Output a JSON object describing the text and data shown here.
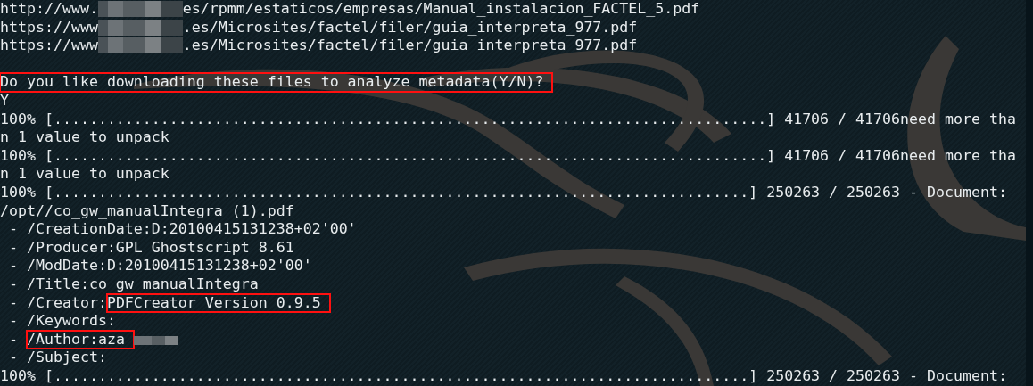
{
  "terminal": {
    "lines": [
      {
        "kind": "text",
        "segments": [
          {
            "kind": "text",
            "text": "http://www.",
            "highlighted": false
          },
          {
            "kind": "blur"
          },
          {
            "kind": "text",
            "text": "es/rpmm/estaticos/empresas/Manual_instalacion_FACTEL_5.pdf",
            "highlighted": false
          }
        ]
      },
      {
        "kind": "text",
        "segments": [
          {
            "kind": "text",
            "text": "https://www",
            "highlighted": false
          },
          {
            "kind": "blur"
          },
          {
            "kind": "text",
            "text": ".es/Microsites/factel/filer/guia_interpreta_977.pdf",
            "highlighted": false
          }
        ]
      },
      {
        "kind": "text",
        "segments": [
          {
            "kind": "text",
            "text": "https://www",
            "highlighted": false
          },
          {
            "kind": "blur"
          },
          {
            "kind": "text",
            "text": ".es/Microsites/factel/filer/guia_interpreta_977.pdf",
            "highlighted": false
          }
        ]
      },
      {
        "kind": "blank"
      },
      {
        "kind": "text",
        "segments": [
          {
            "kind": "text",
            "text": "Do you like downloading these files to analyze metadata(Y/N)?",
            "highlighted": true
          }
        ]
      },
      {
        "kind": "text",
        "segments": [
          {
            "kind": "text",
            "text": "Y",
            "highlighted": false
          }
        ]
      },
      {
        "kind": "text",
        "segments": [
          {
            "kind": "text",
            "text": "100% [................................................................................] 41706 / 41706need more tha",
            "highlighted": false
          }
        ]
      },
      {
        "kind": "text",
        "segments": [
          {
            "kind": "text",
            "text": "n 1 value to unpack",
            "highlighted": false
          }
        ]
      },
      {
        "kind": "text",
        "segments": [
          {
            "kind": "text",
            "text": "100% [................................................................................] 41706 / 41706need more tha",
            "highlighted": false
          }
        ]
      },
      {
        "kind": "text",
        "segments": [
          {
            "kind": "text",
            "text": "n 1 value to unpack",
            "highlighted": false
          }
        ]
      },
      {
        "kind": "text",
        "segments": [
          {
            "kind": "text",
            "text": "100% [..............................................................................] 250263 / 250263 - Document:",
            "highlighted": false
          }
        ]
      },
      {
        "kind": "text",
        "segments": [
          {
            "kind": "text",
            "text": "/opt//co_gw_manualIntegra (1).pdf",
            "highlighted": false
          }
        ]
      },
      {
        "kind": "text",
        "segments": [
          {
            "kind": "text",
            "text": " - /CreationDate:D:20100415131238+02'00'",
            "highlighted": false
          }
        ]
      },
      {
        "kind": "text",
        "segments": [
          {
            "kind": "text",
            "text": " - /Producer:GPL Ghostscript 8.61",
            "highlighted": false
          }
        ]
      },
      {
        "kind": "text",
        "segments": [
          {
            "kind": "text",
            "text": " - /ModDate:D:20100415131238+02'00'",
            "highlighted": false
          }
        ]
      },
      {
        "kind": "text",
        "segments": [
          {
            "kind": "text",
            "text": " - /Title:co_gw_manualIntegra",
            "highlighted": false
          }
        ]
      },
      {
        "kind": "text",
        "segments": [
          {
            "kind": "text",
            "text": " - /Creator:",
            "highlighted": false
          },
          {
            "kind": "text",
            "text": "PDFCreator Version 0.9.5",
            "highlighted": true
          }
        ]
      },
      {
        "kind": "text",
        "segments": [
          {
            "kind": "text",
            "text": " - /Keywords:",
            "highlighted": false
          }
        ]
      },
      {
        "kind": "text",
        "segments": [
          {
            "kind": "text",
            "text": " - ",
            "highlighted": false
          },
          {
            "kind": "text",
            "text": "/Author:aza",
            "highlighted": true
          },
          {
            "kind": "blur-short"
          }
        ]
      },
      {
        "kind": "text",
        "segments": [
          {
            "kind": "text",
            "text": " - /Subject:",
            "highlighted": false
          }
        ]
      },
      {
        "kind": "text",
        "segments": [
          {
            "kind": "text",
            "text": "100% [..............................................................................] 250263 / 250263 - Document:",
            "highlighted": false
          }
        ]
      }
    ]
  }
}
